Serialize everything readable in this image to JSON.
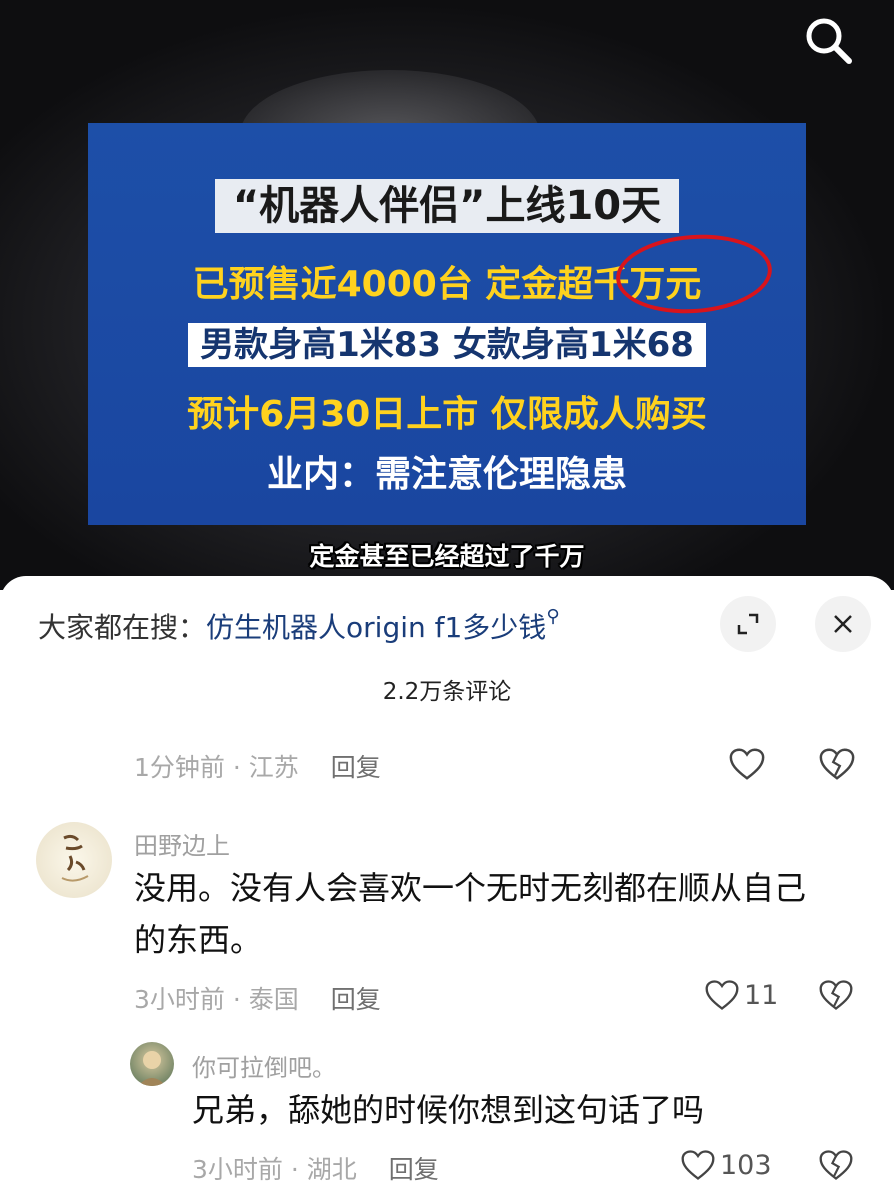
{
  "video": {
    "headline": {
      "line1": "“机器人伴侣”上线10天",
      "line2": "已预售近4000台 定金超千万元",
      "line3": "男款身高1米83 女款身高1米68",
      "line4": "预计6月30日上市 仅限成人购买",
      "line5": "业内：需注意伦理隐患"
    },
    "subtitle": "定金甚至已经超过了千万",
    "icons": {
      "search": "search-icon"
    }
  },
  "comments_panel": {
    "hot_search_prefix": "大家都在搜：",
    "hot_search_query": "仿生机器人origin f1多少钱",
    "comment_count": "2.2万条评论",
    "icons": {
      "expand": "expand-icon",
      "close": "close-icon",
      "like": "heart-icon",
      "dislike": "broken-heart-icon"
    },
    "top_meta": {
      "time": "1分钟前",
      "location": "江苏",
      "reply_label": "回复"
    },
    "comments": [
      {
        "username": "田野边上",
        "text": "没用。没有人会喜欢一个无时无刻都在顺从自己的东西。",
        "time": "3小时前",
        "location": "泰国",
        "reply_label": "回复",
        "likes": "11"
      }
    ],
    "replies": [
      {
        "username": "你可拉倒吧。",
        "text": "兄弟，舔她的时候你想到这句话了吗",
        "time": "3小时前",
        "location": "湖北",
        "reply_label": "回复",
        "likes": "103"
      }
    ]
  }
}
